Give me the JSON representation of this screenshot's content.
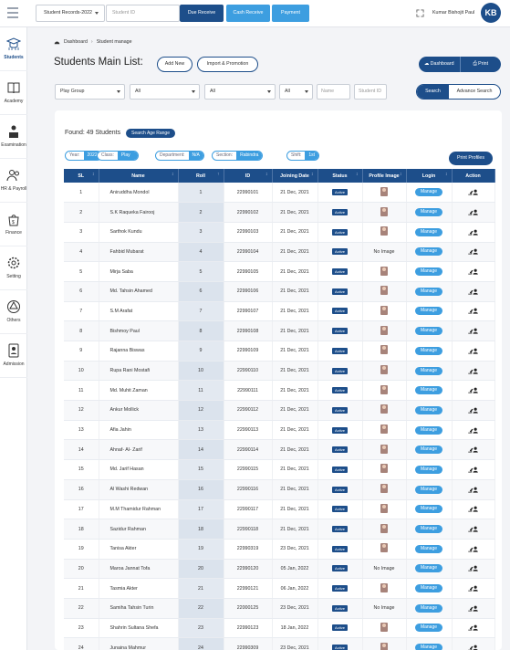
{
  "topbar": {
    "record_select": "Student Records-2022",
    "student_id_placeholder": "Student ID",
    "due_receive": "Due Receive",
    "cash_receive": "Cash Receive",
    "payment": "Payment",
    "user_name": "Kumar Bishojit Paul",
    "avatar": "KB"
  },
  "sidebar": {
    "items": [
      {
        "label": "Students",
        "icon": "graduation-icon"
      },
      {
        "label": "Academy",
        "icon": "book-icon"
      },
      {
        "label": "Examination",
        "icon": "exam-icon"
      },
      {
        "label": "HR & Payroll",
        "icon": "people-icon"
      },
      {
        "label": "Finance",
        "icon": "finance-icon"
      },
      {
        "label": "Setting",
        "icon": "gear-icon"
      },
      {
        "label": "Others",
        "icon": "others-icon"
      },
      {
        "label": "Admission",
        "icon": "admission-icon"
      }
    ]
  },
  "breadcrumb": {
    "home": "Dashboard",
    "current": "Student manage"
  },
  "page": {
    "title": "Students Main List:",
    "add_new": "Add New",
    "import": "Import & Promotion",
    "dashboard": "Dashboard",
    "print": "Print"
  },
  "filters": {
    "group": "Play Group",
    "f2": "All",
    "f3": "All",
    "f4": "All",
    "name_placeholder": "Name",
    "sid_placeholder": "Student ID",
    "search": "Search",
    "advance_search": "Advance Search"
  },
  "summary": {
    "found": "Found: 49 Students",
    "search_age_range": "Search Age Range",
    "print_profiles": "Print Profiles"
  },
  "tags": [
    {
      "k": "Year:",
      "v": "2022"
    },
    {
      "k": "Class:",
      "v": "Play Group"
    },
    {
      "k": "Department:",
      "v": "N/A"
    },
    {
      "k": "Section:",
      "v": "Rabindra House"
    },
    {
      "k": "Shift:",
      "v": "1st"
    }
  ],
  "table": {
    "headers": [
      "SL",
      "Name",
      "Roll",
      "ID",
      "Joining Date",
      "Status",
      "Profile Image",
      "Login",
      "Action"
    ],
    "status_label": "Active",
    "manage_label": "Manage",
    "no_image": "No Image",
    "rows": [
      [
        "1",
        "Aniruddha Mondol",
        "1",
        "22990101",
        "21 Dec, 2021",
        "img"
      ],
      [
        "2",
        "S.K Raqueka Fairooj",
        "2",
        "22990102",
        "21 Dec, 2021",
        "img"
      ],
      [
        "3",
        "Sarthok Kundu",
        "3",
        "22990103",
        "21 Dec, 2021",
        "img"
      ],
      [
        "4",
        "Fahbid Mubarat",
        "4",
        "22990104",
        "21 Dec, 2021",
        "none"
      ],
      [
        "5",
        "Mirja Saba",
        "5",
        "22990105",
        "21 Dec, 2021",
        "img"
      ],
      [
        "6",
        "Md. Tahsin Ahamed",
        "6",
        "22990106",
        "21 Dec, 2021",
        "img"
      ],
      [
        "7",
        "S.M Arafat",
        "7",
        "22990107",
        "21 Dec, 2021",
        "img"
      ],
      [
        "8",
        "Bishmoy Paul",
        "8",
        "22990108",
        "21 Dec, 2021",
        "img"
      ],
      [
        "9",
        "Rajanna Biswas",
        "9",
        "22990109",
        "21 Dec, 2021",
        "img"
      ],
      [
        "10",
        "Rupa Rani Mostafi",
        "10",
        "22990110",
        "21 Dec, 2021",
        "img"
      ],
      [
        "11",
        "Md. Muhit Zaman",
        "11",
        "22990111",
        "21 Dec, 2021",
        "img"
      ],
      [
        "12",
        "Ankur Mollick",
        "12",
        "22990112",
        "21 Dec, 2021",
        "img"
      ],
      [
        "13",
        "Afia Jahin",
        "13",
        "22990113",
        "21 Dec, 2021",
        "img"
      ],
      [
        "14",
        "Ahnaf- Al- Zarif",
        "14",
        "22990114",
        "21 Dec, 2021",
        "img"
      ],
      [
        "15",
        "Md. Jarif Hasan",
        "15",
        "22990115",
        "21 Dec, 2021",
        "img"
      ],
      [
        "16",
        "Al Washi Redwan",
        "16",
        "22990116",
        "21 Dec, 2021",
        "img"
      ],
      [
        "17",
        "M.M Thamidur Rahman",
        "17",
        "22990117",
        "21 Dec, 2021",
        "img"
      ],
      [
        "18",
        "Sazidur Rahman",
        "18",
        "22990118",
        "21 Dec, 2021",
        "img"
      ],
      [
        "19",
        "Tanisa Akter",
        "19",
        "22990319",
        "23 Dec, 2021",
        "img"
      ],
      [
        "20",
        "Maroa Jannat Tofa",
        "20",
        "22990120",
        "05 Jan, 2022",
        "none"
      ],
      [
        "21",
        "Tasmia Akter",
        "21",
        "22990121",
        "06 Jan, 2022",
        "img"
      ],
      [
        "22",
        "Samiha Tahsin Turin",
        "22",
        "22000125",
        "23 Dec, 2021",
        "none"
      ],
      [
        "23",
        "Shahrin Sultana Shefa",
        "23",
        "22990123",
        "18 Jan, 2022",
        "img"
      ],
      [
        "24",
        "Junaina Mahmur",
        "24",
        "22990309",
        "23 Dec, 2021",
        "img"
      ]
    ]
  },
  "colors": {
    "primary": "#1d4e8a",
    "accent": "#3d9ee0"
  }
}
